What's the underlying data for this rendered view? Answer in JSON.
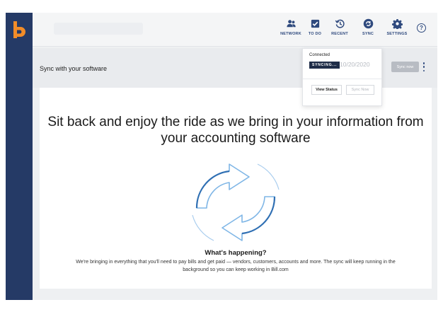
{
  "brand": {
    "logo_letter": "b",
    "logo_color": "#f28c28",
    "rail_color": "#253a66"
  },
  "topbar": {
    "search_placeholder": "",
    "nav": [
      {
        "label": "NETWORK",
        "icon": "people-icon"
      },
      {
        "label": "TO DO",
        "icon": "checklist-icon"
      },
      {
        "label": "RECENT",
        "icon": "history-icon"
      },
      {
        "label": "SYNC",
        "icon": "sync-icon"
      },
      {
        "label": "SETTINGS",
        "icon": "gear-icon"
      }
    ],
    "help": "?"
  },
  "subheader": {
    "title": "Sync with your software",
    "sync_now": "Sync now"
  },
  "popover": {
    "status": "Connected",
    "badge": "SYNCING...",
    "date": "10/20/2020",
    "view_status": "View Status",
    "sync_now": "Sync Now"
  },
  "main": {
    "headline": "Sit back and enjoy the ride as we bring in your information from your accounting software",
    "what_title": "What's happening?",
    "what_body": "We're bringing in everything that you'll need to pay bills and get paid — vendors, customers, accounts and more. The sync will keep running in the background so you can keep working in Bill.com"
  },
  "colors": {
    "accent": "#2f4a7e",
    "arrow_light": "#7fb6e6",
    "arrow_dark": "#2f6fb3"
  }
}
